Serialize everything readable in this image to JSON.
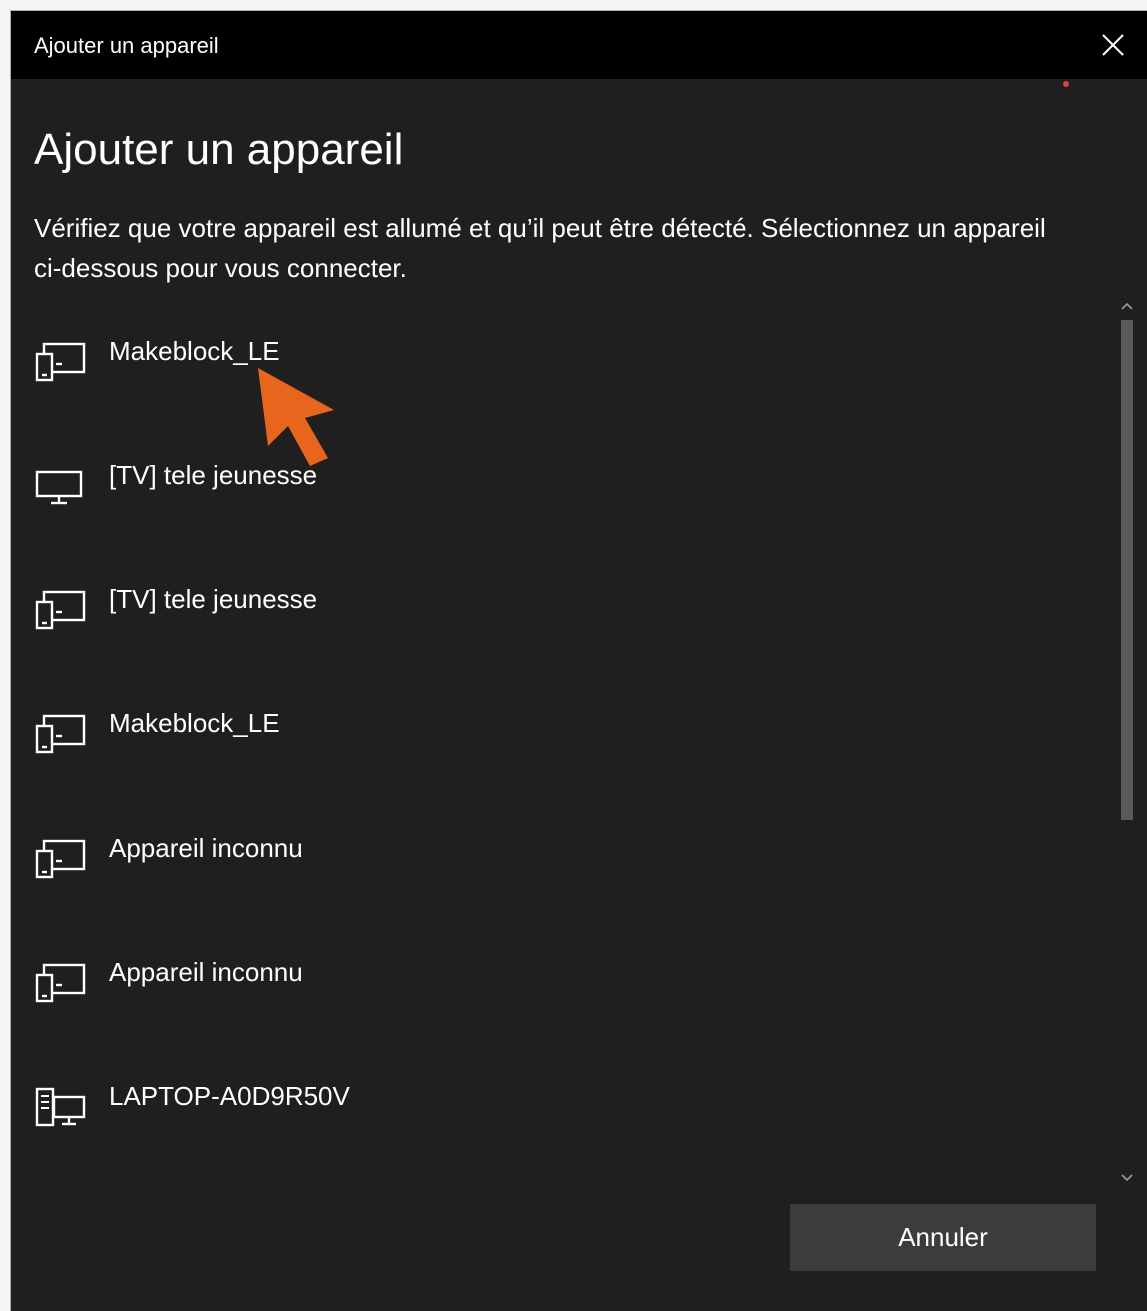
{
  "window": {
    "title": "Ajouter un appareil",
    "close_icon": "close-icon"
  },
  "main": {
    "heading": "Ajouter un appareil",
    "description": "Vérifiez que votre appareil est allumé et qu’il peut être détecté. Sélectionnez un appareil ci-dessous pour vous connecter."
  },
  "devices": [
    {
      "label": "Makeblock_LE",
      "icon": "device-generic-icon"
    },
    {
      "label": "[TV] tele jeunesse",
      "icon": "monitor-icon"
    },
    {
      "label": "[TV] tele jeunesse",
      "icon": "device-generic-icon"
    },
    {
      "label": "Makeblock_LE",
      "icon": "device-generic-icon"
    },
    {
      "label": "Appareil inconnu",
      "icon": "device-generic-icon"
    },
    {
      "label": "Appareil inconnu",
      "icon": "device-generic-icon"
    },
    {
      "label": "LAPTOP-A0D9R50V",
      "icon": "computer-icon"
    }
  ],
  "footer": {
    "cancel_label": "Annuler"
  },
  "annotation": {
    "arrow_color": "#e8651e",
    "arrow_icon": "orange-pointer-arrow"
  },
  "colors": {
    "dialog_background": "#1f1f1f",
    "titlebar_background": "#000000",
    "button_background": "#3c3c3c",
    "text": "#ffffff"
  }
}
